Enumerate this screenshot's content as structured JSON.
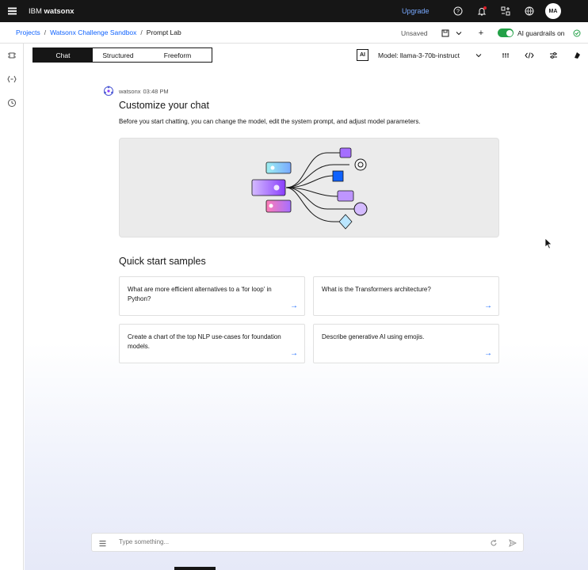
{
  "topbar": {
    "brand_prefix": "IBM",
    "brand_name": "watsonx",
    "upgrade_label": "Upgrade",
    "avatar_initials": "MA",
    "icons": [
      "menu-icon",
      "help-icon",
      "notification-icon",
      "switcher-icon",
      "globe-icon"
    ],
    "notification_dot_color": "#da1e28"
  },
  "breadcrumb": {
    "items": [
      "Projects",
      "Watsonx Challenge Sandbox",
      "Prompt Lab"
    ],
    "status": "Unsaved",
    "new_label": "+",
    "guardrails_label": "AI guardrails on",
    "guardrails_on": true
  },
  "toolbar": {
    "tabs": [
      "Chat",
      "Structured",
      "Freeform"
    ],
    "active_tab": "Chat",
    "ai_badge": "AI",
    "model_label": "Model: llama-3-70b-instruct",
    "tool_icons": [
      "token-icon",
      "code-icon",
      "parameters-icon",
      "library-icon"
    ]
  },
  "chat": {
    "sender": "watsonx",
    "time": "03:48 PM",
    "heading": "Customize your chat",
    "description": "Before you start chatting, you can change the model, edit the system prompt, and adjust model parameters."
  },
  "quick_start": {
    "title": "Quick start samples",
    "samples": [
      {
        "text": "What are more efficient alternatives to a 'for loop' in Python?"
      },
      {
        "text": "What is the Transformers architecture?"
      },
      {
        "text": "Create a chart of the top NLP use-cases for foundation models."
      },
      {
        "text": "Describe generative AI using emojis."
      }
    ],
    "arrow": "→"
  },
  "composer": {
    "placeholder": "Type something..."
  },
  "colors": {
    "accent": "#0f62fe",
    "topbar": "#161616",
    "toggle_on": "#24a148",
    "upgrade": "#78a9ff"
  }
}
